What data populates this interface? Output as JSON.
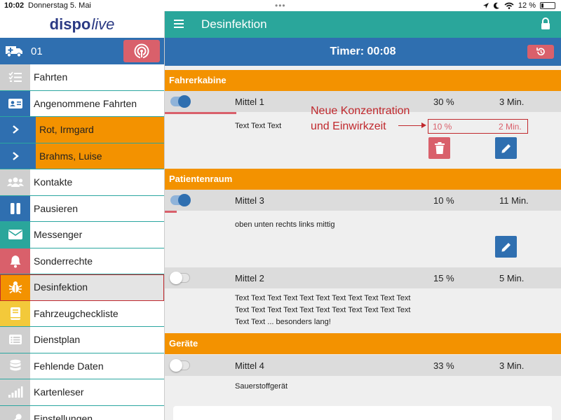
{
  "status": {
    "time": "10:02",
    "date": "Donnerstag 5. Mai",
    "battery": "12 %"
  },
  "sidebar": {
    "logo_a": "dispo",
    "logo_b": "live",
    "vehicle_number": "01",
    "items": [
      {
        "label": "Fahrten",
        "icon": "checklist-icon",
        "color": "#cfcfcf"
      },
      {
        "label": "Angenommene Fahrten",
        "icon": "id-card-icon",
        "color": "#2f6fb0"
      },
      {
        "label": "Rot, Irmgard",
        "icon": "chevron-right-icon",
        "color": "#2f6fb0"
      },
      {
        "label": "Brahms, Luise",
        "icon": "chevron-right-icon",
        "color": "#2f6fb0"
      },
      {
        "label": "Kontakte",
        "icon": "people-icon",
        "color": "#cfcfcf"
      },
      {
        "label": "Pausieren",
        "icon": "pause-icon",
        "color": "#2f6fb0"
      },
      {
        "label": "Messenger",
        "icon": "envelope-icon",
        "color": "#2aa69b"
      },
      {
        "label": "Sonderrechte",
        "icon": "bell-icon",
        "color": "#d9606b"
      },
      {
        "label": "Desinfektion",
        "icon": "bug-icon",
        "color": "#f39200"
      },
      {
        "label": "Fahrzeugcheckliste",
        "icon": "book-icon",
        "color": "#f3c93a"
      },
      {
        "label": "Dienstplan",
        "icon": "list-icon",
        "color": "#cfcfcf"
      },
      {
        "label": "Fehlende Daten",
        "icon": "database-icon",
        "color": "#cfcfcf"
      },
      {
        "label": "Kartenleser",
        "icon": "signal-bars-icon",
        "color": "#cfcfcf"
      },
      {
        "label": "Einstellungen",
        "icon": "wrench-icon",
        "color": "#cfcfcf"
      }
    ]
  },
  "header": {
    "title": "Desinfektion",
    "timer": "Timer: 00:08"
  },
  "sections": {
    "fahrerkabine": "Fahrerkabine",
    "patientenraum": "Patientenraum",
    "geraete": "Geräte"
  },
  "items": {
    "mittel1": {
      "name": "Mittel 1",
      "pct": "30 %",
      "min": "3 Min.",
      "desc": "Text Text Text",
      "new_pct": "10 %",
      "new_min": "2 Min.",
      "progress": 0.18
    },
    "mittel3": {
      "name": "Mittel 3",
      "pct": "10 %",
      "min": "11 Min.",
      "desc": "oben unten rechts links mittig",
      "progress": 0.03
    },
    "mittel2": {
      "name": "Mittel 2",
      "pct": "15 %",
      "min": "5 Min.",
      "desc1": "Text Text Text Text Text Text Text Text Text Text Text",
      "desc2": "Text Text Text Text Text Text Text Text Text Text Text",
      "desc3": "Text Text ... besonders lang!"
    },
    "mittel4": {
      "name": "Mittel 4",
      "pct": "33 %",
      "min": "3 Min.",
      "desc": "Sauerstoffgerät"
    }
  },
  "annotation": {
    "line1": "Neue Konzentration",
    "line2": "und Einwirkzeit"
  },
  "colors": {
    "teal": "#2aa69b",
    "blue": "#2f6fb0",
    "orange": "#f39200",
    "red": "#d9606b"
  }
}
